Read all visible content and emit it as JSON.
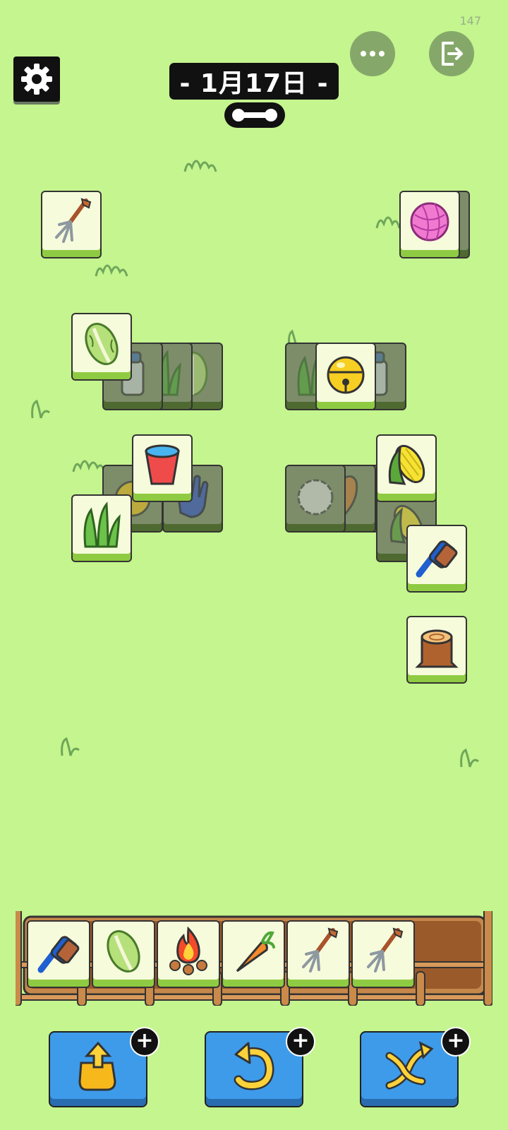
{
  "status": {
    "fps": "147"
  },
  "header": {
    "date_label": "- 1月17日 -",
    "settings_icon": "gear-icon",
    "more_icon": "ellipsis-icon",
    "exit_icon": "exit-icon",
    "badge_icon": "bone-icon"
  },
  "board": {
    "tiles": [
      {
        "item": "pitchfork",
        "state": "free"
      },
      {
        "item": "yarn-ball",
        "state": "free"
      },
      {
        "item": "napa-cabbage",
        "state": "free"
      },
      {
        "item": "bell",
        "state": "free"
      },
      {
        "item": "red-bucket",
        "state": "free"
      },
      {
        "item": "corn",
        "state": "free"
      },
      {
        "item": "grass",
        "state": "free"
      },
      {
        "item": "blue-brush",
        "state": "free"
      },
      {
        "item": "tree-stump",
        "state": "free"
      },
      {
        "item": "milk-can",
        "state": "blocked"
      },
      {
        "item": "grass",
        "state": "blocked"
      },
      {
        "item": "napa-cabbage",
        "state": "blocked"
      },
      {
        "item": "milk-can",
        "state": "blocked"
      },
      {
        "item": "bell",
        "state": "blocked"
      },
      {
        "item": "blue-glove",
        "state": "blocked"
      },
      {
        "item": "wool",
        "state": "blocked"
      },
      {
        "item": "sweet-potato",
        "state": "blocked"
      },
      {
        "item": "blue-glove",
        "state": "blocked"
      },
      {
        "item": "corn",
        "state": "blocked"
      }
    ]
  },
  "tray": {
    "capacity": 7,
    "slots": [
      "blue-brush",
      "napa-cabbage",
      "campfire",
      "carrot",
      "pitchfork",
      "pitchfork"
    ]
  },
  "tools": [
    {
      "name": "pop-out",
      "icon": "hand-up-icon",
      "plus": "+"
    },
    {
      "name": "undo",
      "icon": "undo-arrow-icon",
      "plus": "+"
    },
    {
      "name": "shuffle",
      "icon": "shuffle-arrows-icon",
      "plus": "+"
    }
  ],
  "colors": {
    "background": "#c4f58e",
    "tile_face": "#f6fbdc",
    "tile_base": "#8fcb42",
    "button_blue": "#3d9bea"
  }
}
